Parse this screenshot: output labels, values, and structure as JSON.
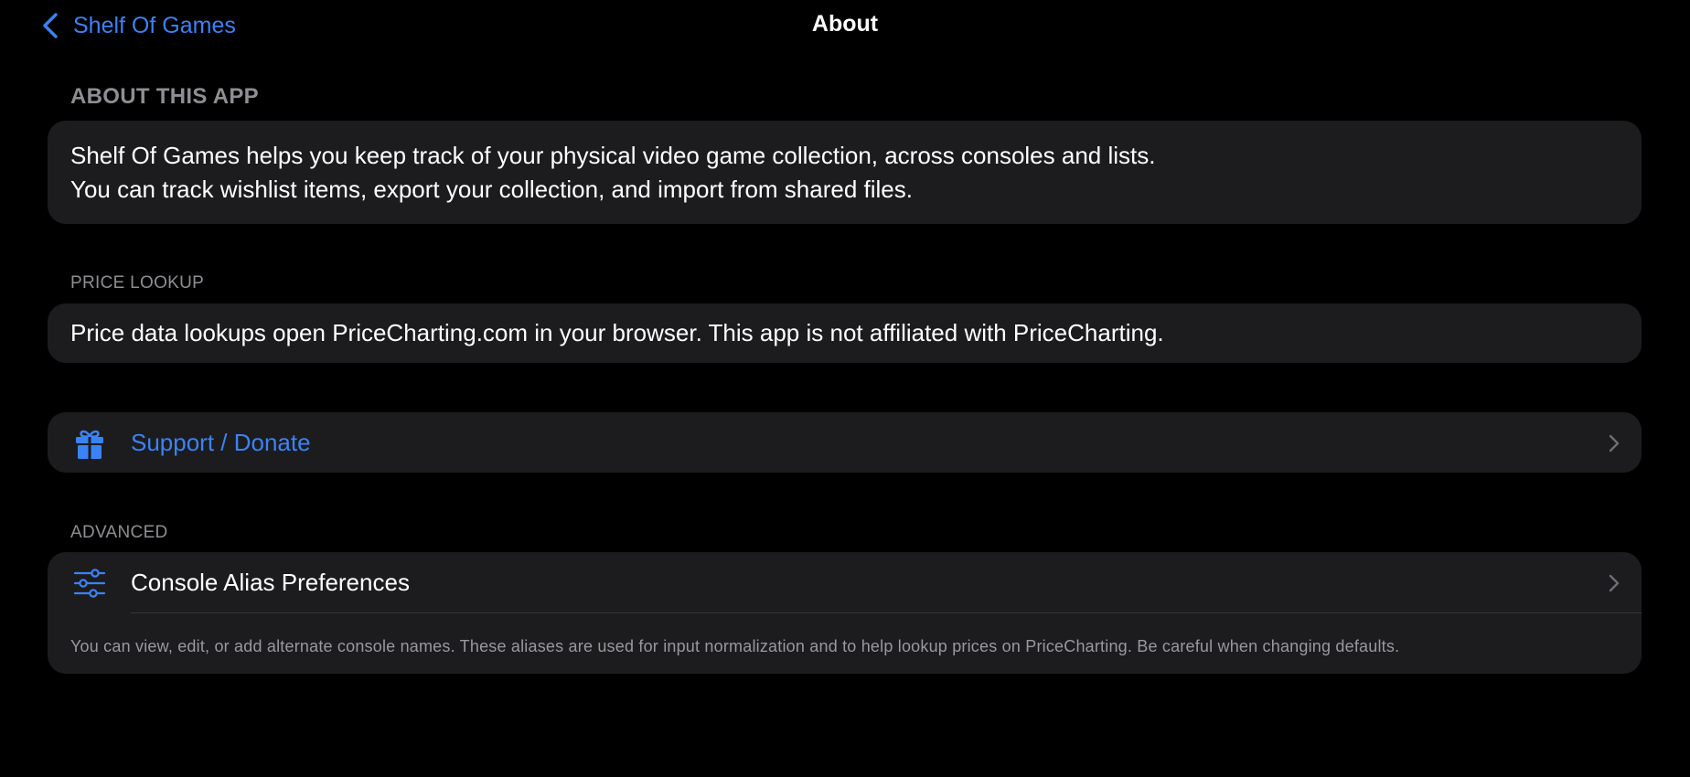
{
  "nav": {
    "back_label": "Shelf Of Games",
    "title": "About"
  },
  "about": {
    "header": "ABOUT THIS APP",
    "line1": "Shelf Of Games helps you keep track of your physical video game collection, across consoles and lists.",
    "line2": "You can track wishlist items, export your collection, and import from shared files."
  },
  "price_lookup": {
    "header": "PRICE LOOKUP",
    "text": "Price data lookups open PriceCharting.com in your browser. This app is not affiliated with PriceCharting."
  },
  "support": {
    "label": "Support / Donate",
    "icon": "gift-icon"
  },
  "advanced": {
    "header": "ADVANCED",
    "row_label": "Console Alias Preferences",
    "row_icon": "sliders-icon",
    "footnote": "You can view, edit, or add alternate console names. These aliases are used for input normalization and to help lookup prices on PriceCharting. Be careful when changing defaults."
  },
  "colors": {
    "accent": "#3b82f6",
    "background": "#000000",
    "card": "#1c1c1e",
    "secondary_text": "#8e8e93"
  }
}
